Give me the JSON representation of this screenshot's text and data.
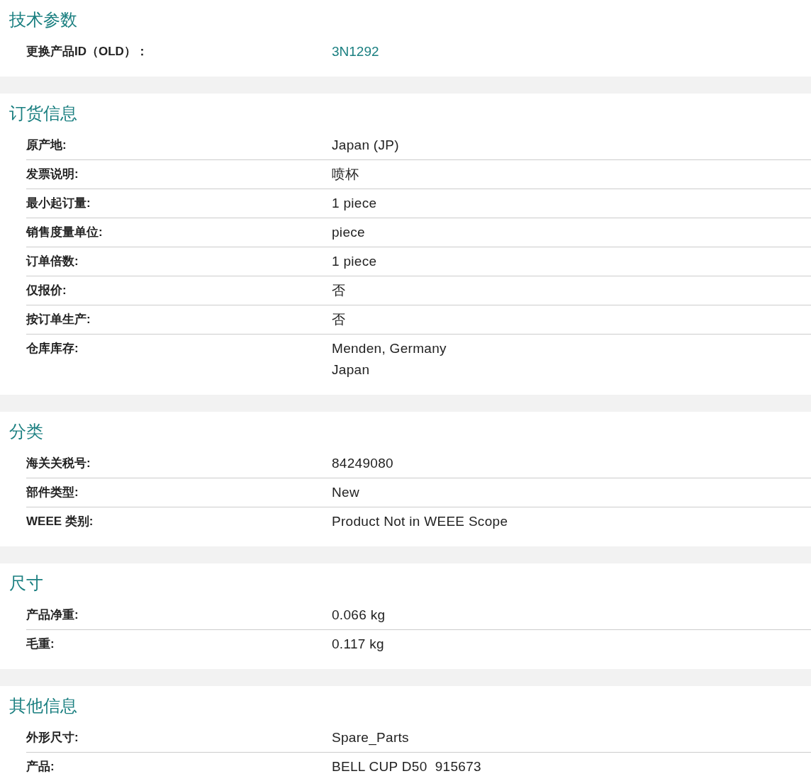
{
  "sections": [
    {
      "title": "技术参数",
      "rows": [
        {
          "label": "更换产品ID（OLD）：",
          "kind": "link",
          "values": [
            "3N1292"
          ]
        }
      ]
    },
    {
      "title": "订货信息",
      "rows": [
        {
          "label": "原产地:",
          "kind": "text",
          "values": [
            "Japan (JP)"
          ]
        },
        {
          "label": "发票说明:",
          "kind": "text",
          "values": [
            "喷杯"
          ]
        },
        {
          "label": "最小起订量:",
          "kind": "text",
          "values": [
            "1 piece"
          ]
        },
        {
          "label": "销售度量单位:",
          "kind": "text",
          "values": [
            "piece"
          ]
        },
        {
          "label": "订单倍数:",
          "kind": "text",
          "values": [
            "1 piece"
          ]
        },
        {
          "label": "仅报价:",
          "kind": "text",
          "values": [
            "否"
          ]
        },
        {
          "label": "按订单生产:",
          "kind": "text",
          "values": [
            "否"
          ]
        },
        {
          "label": "仓库库存:",
          "kind": "text",
          "values": [
            "Menden, Germany",
            "Japan"
          ]
        }
      ]
    },
    {
      "title": "分类",
      "rows": [
        {
          "label": "海关关税号:",
          "kind": "text",
          "values": [
            "84249080"
          ]
        },
        {
          "label": "部件类型:",
          "kind": "text",
          "values": [
            "New"
          ]
        },
        {
          "label": "WEEE 类别:",
          "kind": "text",
          "values": [
            "Product Not in WEEE Scope"
          ]
        }
      ]
    },
    {
      "title": "尺寸",
      "rows": [
        {
          "label": "产品净重:",
          "kind": "text",
          "values": [
            "0.066 kg"
          ]
        },
        {
          "label": "毛重:",
          "kind": "text",
          "values": [
            "0.117 kg"
          ]
        }
      ]
    },
    {
      "title": "其他信息",
      "rows": [
        {
          "label": "外形尺寸:",
          "kind": "text",
          "values": [
            "Spare_Parts"
          ]
        },
        {
          "label": "产品:",
          "kind": "text",
          "values": [
            "BELL CUP D50  915673"
          ]
        }
      ]
    }
  ]
}
